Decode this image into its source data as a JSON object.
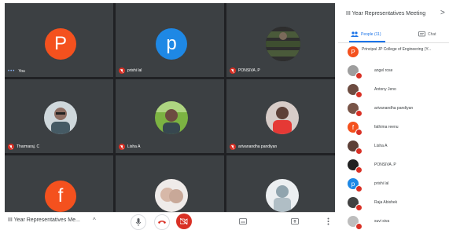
{
  "meeting": {
    "title": "III Year Representatives Meeting",
    "bottom_title": "III Year Representatives Me..."
  },
  "tiles": [
    {
      "name": "You",
      "initial": "P",
      "color": "#f4511e",
      "kind": "letter",
      "mic": "speaking"
    },
    {
      "name": "prishi lal",
      "initial": "p",
      "color": "#1e88e5",
      "kind": "letter",
      "mic": "off"
    },
    {
      "name": "PONSIVA .P",
      "kind": "photo",
      "mic": "off"
    },
    {
      "name": "Tharmaraj. C",
      "kind": "photo",
      "mic": "off"
    },
    {
      "name": "Lisha A",
      "kind": "photo",
      "mic": "off"
    },
    {
      "name": "arivanandha pandiyan",
      "kind": "photo",
      "mic": "off"
    },
    {
      "name": "",
      "initial": "f",
      "color": "#f4511e",
      "kind": "letter",
      "mic": "none"
    },
    {
      "name": "",
      "kind": "photo",
      "mic": "none"
    },
    {
      "name": "",
      "kind": "photo",
      "mic": "none"
    }
  ],
  "tabs": {
    "people": "People (11)",
    "chat": "Chat"
  },
  "participants": [
    {
      "name": "Principal JP College of Engineering (Y...",
      "initial": "P",
      "color": "#f4511e"
    },
    {
      "name": "angel rose",
      "initial": "",
      "color": "#9e9e9e"
    },
    {
      "name": "Antony Jeno",
      "initial": "",
      "color": "#6d4c41"
    },
    {
      "name": "arivanandha pandiyan",
      "initial": "",
      "color": "#795548"
    },
    {
      "name": "fathima reenu",
      "initial": "f",
      "color": "#f4511e"
    },
    {
      "name": "Lisha A",
      "initial": "",
      "color": "#5d4037"
    },
    {
      "name": "PONSIVA .P",
      "initial": "",
      "color": "#212121"
    },
    {
      "name": "prishi lal",
      "initial": "p",
      "color": "#1e88e5"
    },
    {
      "name": "Raja Abishek",
      "initial": "",
      "color": "#424242"
    },
    {
      "name": "suvi siva",
      "initial": "",
      "color": "#bdbdbd"
    }
  ]
}
